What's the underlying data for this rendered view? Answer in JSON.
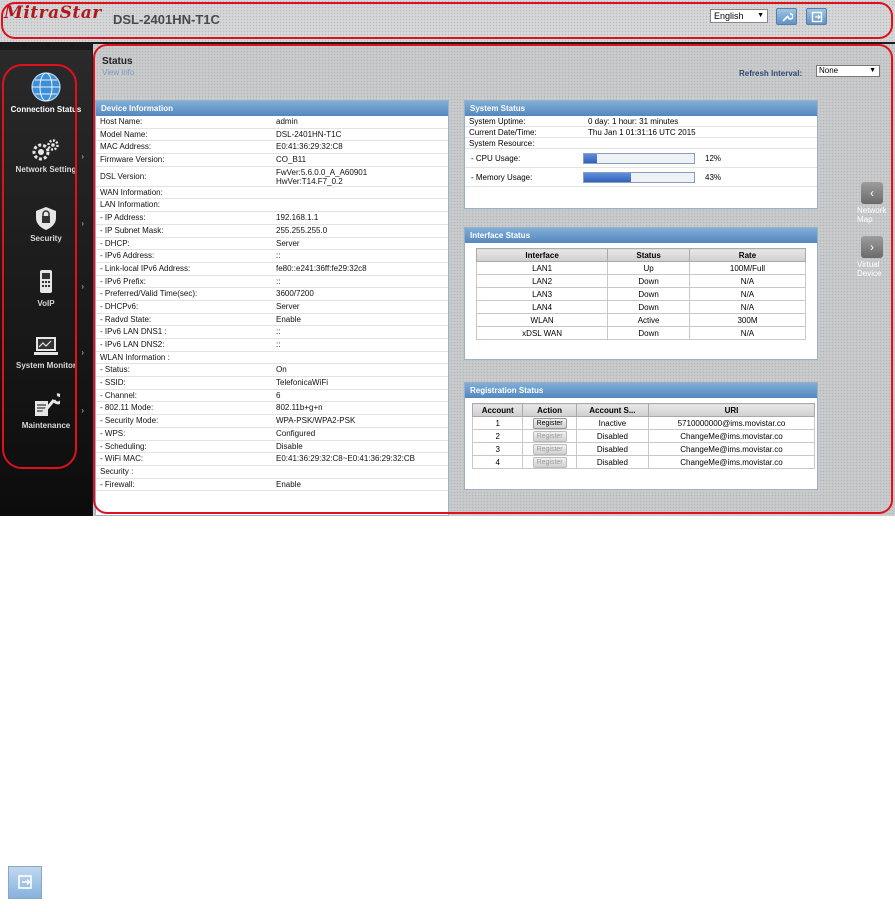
{
  "header": {
    "logo": "MitraStar",
    "model": "DSL-2401HN-T1C",
    "language": "English",
    "tool_icon": "wrench-icon",
    "logout_icon": "logout-icon"
  },
  "sidebar": {
    "items": [
      {
        "label": "Connection Status",
        "icon": "globe-icon",
        "active": true
      },
      {
        "label": "Network Setting",
        "icon": "gears-icon"
      },
      {
        "label": "Security",
        "icon": "shield-icon"
      },
      {
        "label": "VoIP",
        "icon": "phone-icon"
      },
      {
        "label": "System Monitor",
        "icon": "monitor-icon"
      },
      {
        "label": "Maintenance",
        "icon": "tools-icon"
      }
    ]
  },
  "page": {
    "title": "Status",
    "subtitle": "View info",
    "refresh_label": "Refresh Interval:",
    "refresh_value": "None"
  },
  "device_info": {
    "title": "Device Information",
    "rows": [
      {
        "k": "Host Name:",
        "v": "admin"
      },
      {
        "k": "Model Name:",
        "v": "DSL-2401HN-T1C"
      },
      {
        "k": "MAC Address:",
        "v": "E0:41:36:29:32:C8"
      },
      {
        "k": "Firmware Version:",
        "v": "CO_B11"
      },
      {
        "k": "DSL Version:",
        "v": "FwVer:5.6.0.0_A_A60901",
        "v2": "HwVer:T14.F7_0.2"
      },
      {
        "k": "WAN Information:",
        "v": ""
      },
      {
        "k": "LAN Information:",
        "v": ""
      },
      {
        "k": "- IP Address:",
        "v": "192.168.1.1"
      },
      {
        "k": "- IP Subnet Mask:",
        "v": "255.255.255.0"
      },
      {
        "k": "- DHCP:",
        "v": "Server"
      },
      {
        "k": "- IPv6 Address:",
        "v": "::"
      },
      {
        "k": "- Link-local IPv6 Address:",
        "v": "fe80::e241:36ff:fe29:32c8"
      },
      {
        "k": "- IPv6 Prefix:",
        "v": "::"
      },
      {
        "k": "- Preferred/Valid Time(sec):",
        "v": "3600/7200"
      },
      {
        "k": "- DHCPv6:",
        "v": "Server"
      },
      {
        "k": "- Radvd State:",
        "v": "Enable"
      },
      {
        "k": "- IPv6 LAN DNS1 :",
        "v": "::"
      },
      {
        "k": "- IPv6 LAN DNS2:",
        "v": "::"
      },
      {
        "k": "WLAN Information :",
        "v": ""
      },
      {
        "k": "- Status:",
        "v": "On"
      },
      {
        "k": "- SSID:",
        "v": "TelefonicaWiFi"
      },
      {
        "k": "- Channel:",
        "v": "6"
      },
      {
        "k": "- 802.11 Mode:",
        "v": "802.11b+g+n"
      },
      {
        "k": "- Security Mode:",
        "v": "WPA-PSK/WPA2-PSK"
      },
      {
        "k": "- WPS:",
        "v": "Configured"
      },
      {
        "k": "- Scheduling:",
        "v": "Disable"
      },
      {
        "k": "- WiFi MAC:",
        "v": "E0:41:36:29:32:C8~E0:41:36:29:32:CB"
      },
      {
        "k": "Security :",
        "v": ""
      },
      {
        "k": "- Firewall:",
        "v": "Enable"
      }
    ]
  },
  "system_status": {
    "title": "System Status",
    "uptime_label": "System Uptime:",
    "uptime": "0 day: 1 hour: 31 minutes",
    "datetime_label": "Current Date/Time:",
    "datetime": "Thu Jan 1 01:31:16 UTC 2015",
    "resource_label": "System Resource:",
    "cpu_label": "- CPU Usage:",
    "cpu_pct": "12%",
    "cpu_fraction": 0.12,
    "mem_label": "- Memory Usage:",
    "mem_pct": "43%",
    "mem_fraction": 0.43
  },
  "interface_status": {
    "title": "Interface Status",
    "headers": [
      "Interface",
      "Status",
      "Rate"
    ],
    "rows": [
      [
        "LAN1",
        "Up",
        "100M/Full"
      ],
      [
        "LAN2",
        "Down",
        "N/A"
      ],
      [
        "LAN3",
        "Down",
        "N/A"
      ],
      [
        "LAN4",
        "Down",
        "N/A"
      ],
      [
        "WLAN",
        "Active",
        "300M"
      ],
      [
        "xDSL WAN",
        "Down",
        "N/A"
      ]
    ]
  },
  "registration_status": {
    "title": "Registration Status",
    "headers": [
      "Account",
      "Action",
      "Account S...",
      "URI"
    ],
    "button_label": "Register",
    "rows": [
      {
        "account": "1",
        "status": "Inactive",
        "uri": "5710000000@ims.movistar.co",
        "enabled": true
      },
      {
        "account": "2",
        "status": "Disabled",
        "uri": "ChangeMe@ims.movistar.co",
        "enabled": false
      },
      {
        "account": "3",
        "status": "Disabled",
        "uri": "ChangeMe@ims.movistar.co",
        "enabled": false
      },
      {
        "account": "4",
        "status": "Disabled",
        "uri": "ChangeMe@ims.movistar.co",
        "enabled": false
      }
    ]
  },
  "right_nav": {
    "items": [
      {
        "label": "Network Map",
        "icon": "chevron-left-icon"
      },
      {
        "label": "Virtual Device",
        "icon": "chevron-right-icon"
      }
    ]
  },
  "footer_icon": "logout-icon",
  "colors": {
    "highlight": "#e0101e",
    "brand": "#b3181f",
    "panel_header": "#5f92c6"
  }
}
